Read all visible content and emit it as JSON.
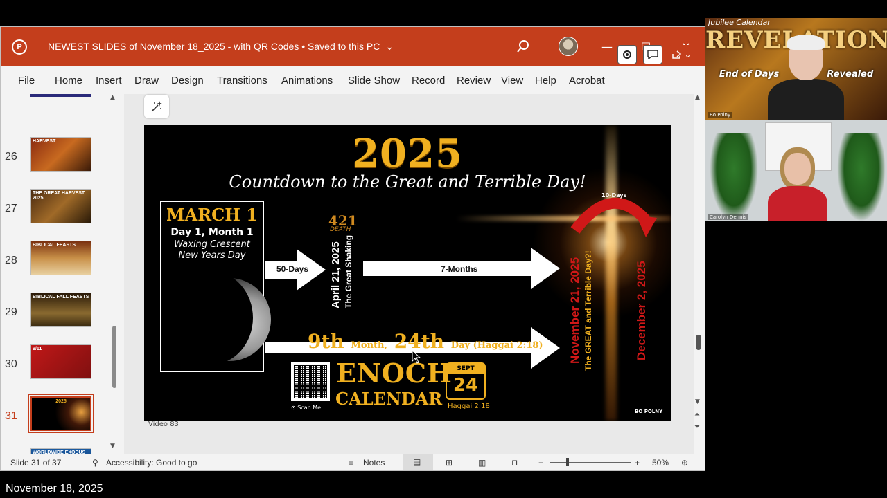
{
  "window": {
    "title": "NEWEST SLIDES of November 18_2025 - with QR Codes",
    "save_status": "Saved to this PC",
    "app_icon_letter": "P"
  },
  "menu": {
    "items": [
      "File",
      "Home",
      "Insert",
      "Draw",
      "Design",
      "Transitions",
      "Animations",
      "Slide Show",
      "Record",
      "Review",
      "View",
      "Help",
      "Acrobat"
    ]
  },
  "thumbnails": [
    {
      "num": "26",
      "label": "HARVEST",
      "bg": "#6a2a10"
    },
    {
      "num": "27",
      "label": "THE GREAT HARVEST 2025",
      "bg": "#5a3a1a"
    },
    {
      "num": "28",
      "label": "BIBLICAL FEASTS",
      "bg": "#7a5020"
    },
    {
      "num": "29",
      "label": "BIBLICAL FALL FEASTS",
      "bg": "#3a2a10"
    },
    {
      "num": "30",
      "label": "9/11",
      "bg": "#a01818"
    },
    {
      "num": "31",
      "label": "2025",
      "bg": "#111111"
    },
    {
      "num": "32",
      "label": "WORLDWIDE EXODUS",
      "bg": "#1a4a8a"
    }
  ],
  "slide": {
    "year": "2025",
    "subtitle": "Countdown to the Great and Terrible Day!",
    "march_title": "MARCH 1",
    "march_line1": "Day 1, Month 1",
    "march_line2": "Waxing Crescent",
    "march_line3": "New Years Day",
    "arrow1_label": "50-Days",
    "arrow2_label": "7-Months",
    "num421": "421",
    "death": "DEATH",
    "april_date": "April 21, 2025",
    "great_shaking": "The Great Shaking",
    "ninth": "9th",
    "month_word": "Month,",
    "twentyfourth": "24th",
    "day_haggai": "Day (Haggai 2:18)",
    "enoch": "ENOCH",
    "calendar": "CALENDAR",
    "scan_me": "Scan Me",
    "cal_month": "SEPT",
    "cal_day": "24",
    "cal_ref": "Haggai 2:18",
    "ten_days": "10-Days",
    "nov_date": "November 21, 2025",
    "great_day": "The GREAT and Terrible Day?!",
    "dec_date": "December 2, 2025",
    "brand": "BO POLNY",
    "video_label": "Video 83"
  },
  "status": {
    "slide_info": "Slide 31 of 37",
    "accessibility": "Accessibility: Good to go",
    "notes": "Notes",
    "zoom": "50%"
  },
  "tiles": {
    "top_script": "Jubilee Calendar",
    "banner1": "REVELATION",
    "banner2": "End of Days",
    "banner3": "Revealed",
    "name1": "Bo Polny",
    "name2": "Carolyn Dennis"
  },
  "footer_date": "November 18, 2025",
  "colors": {
    "accent": "#c43e1c",
    "gold": "#f0b020",
    "red": "#d01818"
  }
}
